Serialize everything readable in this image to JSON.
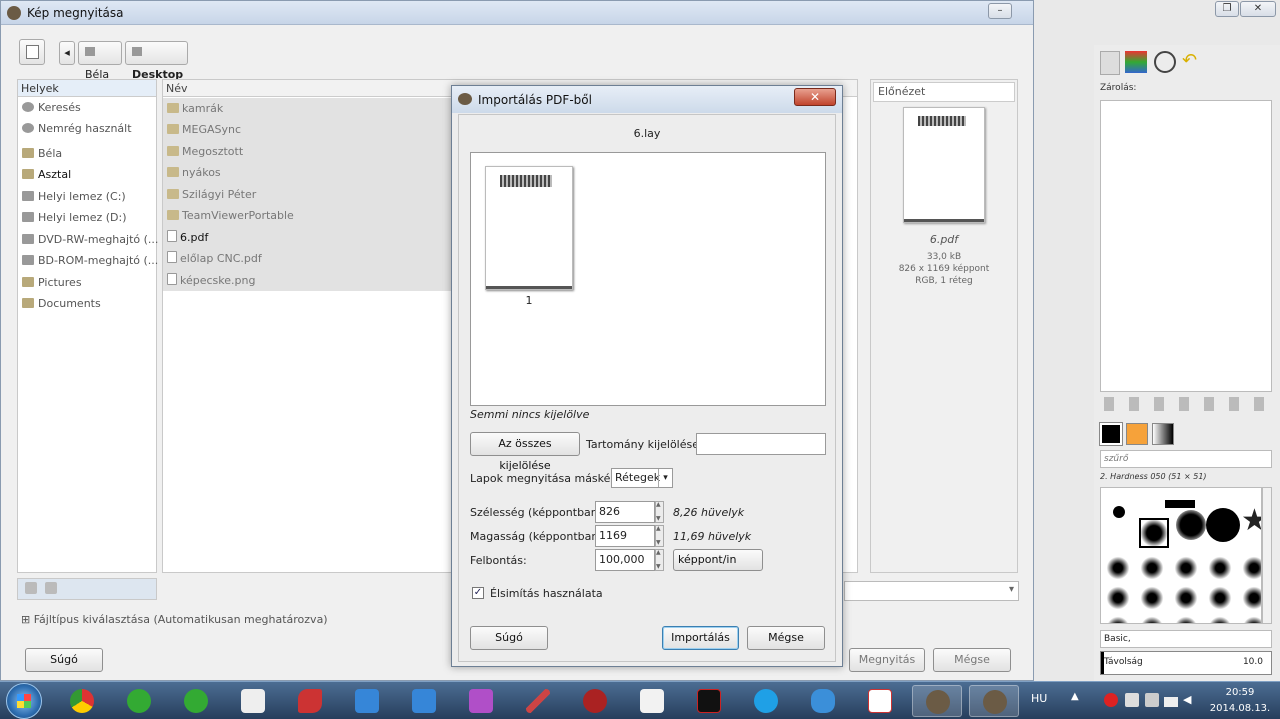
{
  "back_window": {
    "title": "Kép megnyitása",
    "path": {
      "user": "Béla",
      "current": "Desktop"
    },
    "places_header": "Helyek",
    "places": [
      "Keresés",
      "Nemrég használt",
      "Béla",
      "Asztal",
      "Helyi lemez (C:)",
      "Helyi lemez (D:)",
      "DVD-RW-meghajtó (...",
      "BD-ROM-meghajtó (...",
      "Pictures",
      "Documents"
    ],
    "name_header": "Név",
    "files": [
      "kamrák",
      "MEGASync",
      "Megosztott",
      "nyákos",
      "Szilágyi Péter",
      "TeamViewerPortable",
      "6.pdf",
      "előlap CNC.pdf",
      "képecske.png"
    ],
    "preview_header": "Előnézet",
    "preview_file": "6.pdf",
    "preview_size": "33,0 kB",
    "preview_dims": "826 x 1169 képpont",
    "preview_mode": "RGB, 1 réteg",
    "filetype_label": "Fájltípus kiválasztása (Automatikusan meghatározva)",
    "help_button": "Súgó",
    "open_button": "Megnyitás",
    "cancel_button": "Mégse"
  },
  "dialog": {
    "title": "Importálás PDF-ből",
    "doc_name": "6.lay",
    "page_number": "1",
    "selection_status": "Semmi nincs kijelölve",
    "select_all": "Az összes kijelölése",
    "range_label": "Tartomány kijelölése:",
    "range_value": "",
    "open_pages_as_label": "Lapok megnyitása másként",
    "open_pages_as_value": "Rétegek",
    "width_label": "Szélesség (képpontban):",
    "width_value": "826",
    "width_inches": "8,26 hüvelyk",
    "height_label": "Magasság (képpontban):",
    "height_value": "1169",
    "height_inches": "11,69 hüvelyk",
    "resolution_label": "Felbontás:",
    "resolution_value": "100,000",
    "resolution_unit": "képpont/in",
    "antialias_label": "Élsimítás használata",
    "antialias_checked": true,
    "help": "Súgó",
    "import": "Importálás",
    "cancel": "Mégse"
  },
  "dock": {
    "lock_label": "Zárolás:",
    "filter_placeholder": "szűrő",
    "brush_name": "2. Hardness 050 (51 × 51)",
    "brush_set": "Basic,",
    "distance_label": "Távolság",
    "distance_value": "10.0"
  },
  "taskbar": {
    "lang": "HU",
    "time": "20:59",
    "date": "2014.08.13."
  }
}
